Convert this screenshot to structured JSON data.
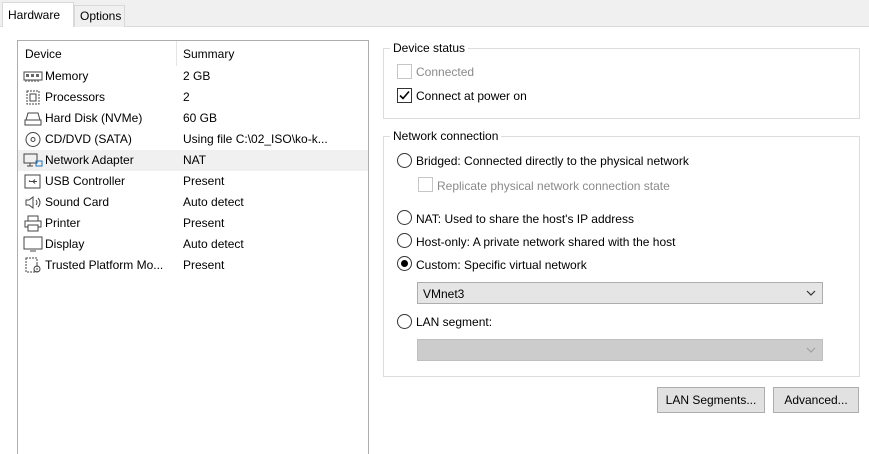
{
  "tabs": [
    {
      "label": "Hardware",
      "active": true
    },
    {
      "label": "Options",
      "active": false
    }
  ],
  "device_list": {
    "columns": [
      "Device",
      "Summary"
    ],
    "rows": [
      {
        "icon": "memory-icon",
        "device": "Memory",
        "summary": "2 GB"
      },
      {
        "icon": "processor-icon",
        "device": "Processors",
        "summary": "2"
      },
      {
        "icon": "hard-disk-icon",
        "device": "Hard Disk (NVMe)",
        "summary": "60 GB"
      },
      {
        "icon": "cd-dvd-icon",
        "device": "CD/DVD (SATA)",
        "summary": "Using file C:\\02_ISO\\ko-k..."
      },
      {
        "icon": "network-adapter-icon",
        "device": "Network Adapter",
        "summary": "NAT",
        "selected": true
      },
      {
        "icon": "usb-icon",
        "device": "USB Controller",
        "summary": "Present"
      },
      {
        "icon": "sound-card-icon",
        "device": "Sound Card",
        "summary": "Auto detect"
      },
      {
        "icon": "printer-icon",
        "device": "Printer",
        "summary": "Present"
      },
      {
        "icon": "display-icon",
        "device": "Display",
        "summary": "Auto detect"
      },
      {
        "icon": "tpm-icon",
        "device": "Trusted Platform Mo...",
        "summary": "Present"
      }
    ]
  },
  "device_status": {
    "title": "Device status",
    "connected": {
      "label": "Connected",
      "checked": false,
      "disabled": true
    },
    "connect_at_power_on": {
      "label": "Connect at power on",
      "checked": true,
      "disabled": false
    }
  },
  "network_connection": {
    "title": "Network connection",
    "bridged": {
      "label": "Bridged: Connected directly to the physical network",
      "selected": false
    },
    "replicate": {
      "label": "Replicate physical network connection state",
      "checked": false,
      "disabled": true
    },
    "nat": {
      "label": "NAT: Used to share the host's IP address",
      "selected": false
    },
    "host_only": {
      "label": "Host-only: A private network shared with the host",
      "selected": false
    },
    "custom": {
      "label": "Custom: Specific virtual network",
      "selected": true
    },
    "custom_select_value": "VMnet3",
    "lan_segment": {
      "label": "LAN segment:",
      "selected": false
    },
    "lan_segment_select_value": ""
  },
  "buttons": {
    "lan_segments": "LAN Segments...",
    "advanced": "Advanced..."
  },
  "colors": {
    "selected_row": "#f0f0f0",
    "button_face": "#e1e1e1",
    "disabled_text": "#8a8a8a"
  }
}
